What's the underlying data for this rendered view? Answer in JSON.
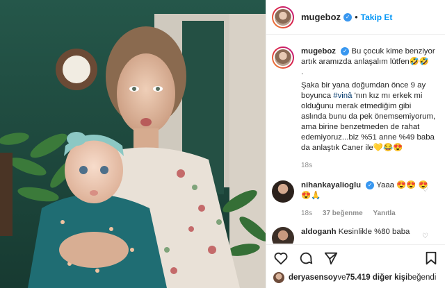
{
  "post": {
    "username": "mugeboz",
    "follow_label": "Takip Et",
    "separator": "•",
    "verified_glyph": "✓"
  },
  "caption": {
    "username": "mugeboz",
    "line1": "Bu çocuk kime benziyor artık aramızda anlaşalım lütfen🤣🤣",
    "dot": ".",
    "line2a": "Şaka bir yana doğumdan önce 9 ay boyunca ",
    "hashtag": "#vinâ",
    "line2b": " 'nın kız mı erkek mi olduğunu merak etmediğim gibi aslında bunu da pek önemsemiyorum, ama birine benzetmeden de rahat edemiyoruz...biz %51 anne %49 baba da anlaştık Caner ile💛😂😍",
    "time": "18s"
  },
  "comments": [
    {
      "username": "nihankayalioglu",
      "text": "Yaaa 😍😍 😍😍🙏",
      "time": "18s",
      "likes": "37 beğenme",
      "reply": "Yanıtla",
      "heart": "♡"
    },
    {
      "username": "aldoganh",
      "text": "Kesinlikle %80 baba",
      "time": "",
      "likes": "",
      "reply": "",
      "heart": "♡"
    }
  ],
  "actions": {
    "icons": [
      "heart-icon",
      "comment-icon",
      "share-icon",
      "bookmark-icon"
    ]
  },
  "likes_bar": {
    "user": "deryasensoy",
    "middle": " ve ",
    "count": "75.419 diğer kişi",
    "tail": " beğendi"
  },
  "colors": {
    "link": "#0095f6",
    "verified": "#3897f0",
    "muted": "#8e8e8e",
    "photo_bg": "#1f4a3e"
  }
}
